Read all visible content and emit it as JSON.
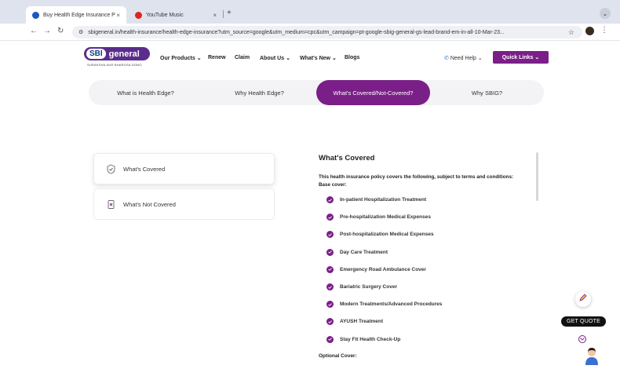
{
  "browser": {
    "tabs": [
      {
        "title": "Buy Health Edge Insurance P",
        "favicon_color": "#1a56c4"
      },
      {
        "title": "YouTube Music",
        "favicon_color": "#e0241c"
      }
    ],
    "tab_close": "×",
    "new_tab": "+",
    "url": "sbigeneral.in/health-insurance/health-edge-insurance?utm_source=google&utm_medium=cpc&utm_campaign=pt-google-sbig-general-gs-lead-brand-em-in-all-10-Mar-23..."
  },
  "header": {
    "logo_sbi": "SBI",
    "logo_general": "general",
    "tagline": "SURAKSHA AUR BHAROSA DONO",
    "nav": [
      "Our Products",
      "Renew",
      "Claim",
      "About Us",
      "What's New",
      "Blogs"
    ],
    "need_help": "Need Help",
    "quick_links": "Quick Links",
    "brand_color": "#7b1f88"
  },
  "section_tabs": {
    "items": [
      "What is Health Edge?",
      "Why Health Edge?",
      "What's Covered/Not-Covered?",
      "Why SBIG?"
    ],
    "active": "What's Covered/Not-Covered?"
  },
  "side_cards": [
    {
      "label": "What's Covered",
      "icon": "shield-icon"
    },
    {
      "label": "What's Not Covered",
      "icon": "document-cross-icon"
    }
  ],
  "covered": {
    "title": "What's Covered",
    "intro": "This health insurance policy covers the following, subject to terms and conditions:",
    "base_label": "Base cover:",
    "items": [
      "In-patient Hospitalization Treatment",
      "Pre-hospitalization Medical Expenses",
      "Post-hospitalization Medical Expenses",
      "Day Care Treatment",
      "Emergency Road Ambulance Cover",
      "Bariatric Surgery Cover",
      "Modern Treatments/Advanced Procedures",
      "AYUSH Treatment",
      "Stay Fit Health Check-Up"
    ],
    "optional_label": "Optional Cover:"
  },
  "widgets": {
    "get_quote": "GET QUOTE"
  }
}
